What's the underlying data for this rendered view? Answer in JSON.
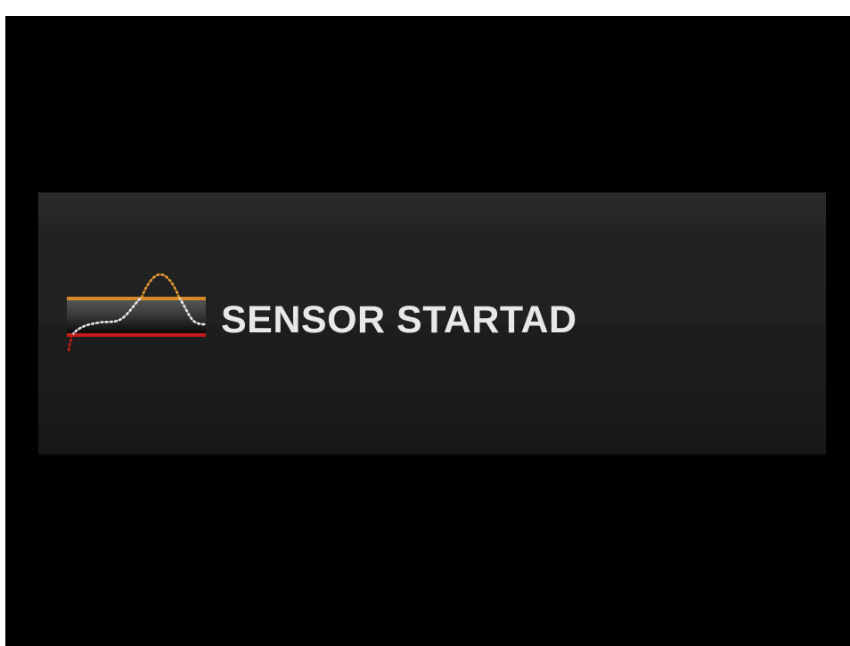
{
  "message": {
    "text": "SENSOR STARTAD",
    "color": "#e8e8e8"
  },
  "icon": {
    "name": "sensor-graph-icon",
    "high_line_color": "#d4882a",
    "low_line_color": "#c41a1a",
    "curve_color": "#e6e6e6",
    "peak_color": "#e69a2e"
  },
  "colors": {
    "background": "#000000",
    "banner": "#222323"
  }
}
